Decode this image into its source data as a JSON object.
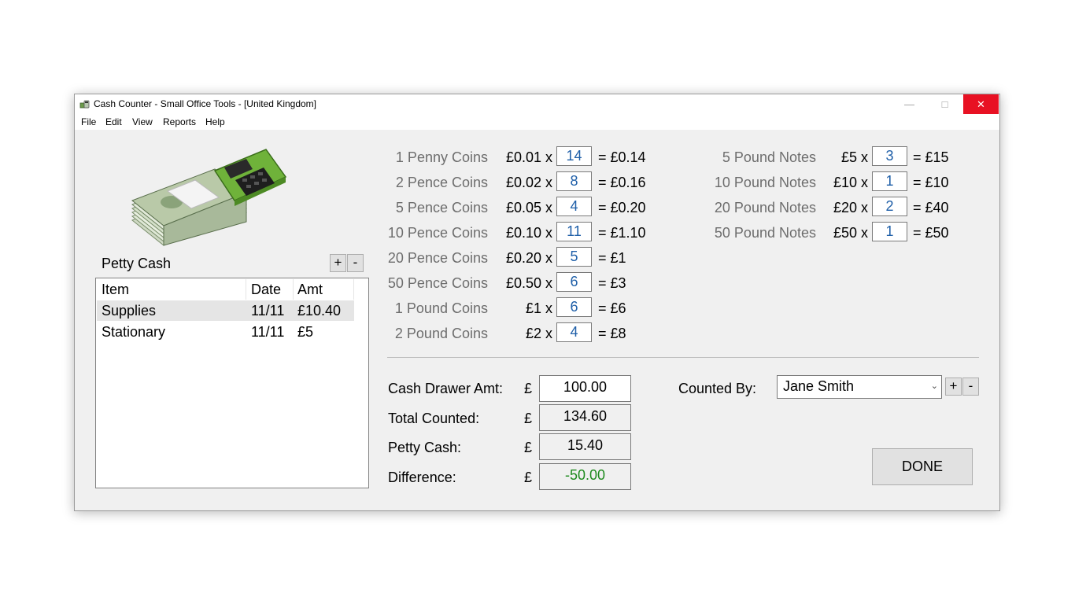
{
  "window": {
    "title": "Cash Counter - Small Office Tools - [United Kingdom]",
    "minimize_glyph": "—",
    "maximize_glyph": "□",
    "close_glyph": "✕"
  },
  "menu": [
    "File",
    "Edit",
    "View",
    "Reports",
    "Help"
  ],
  "petty_cash": {
    "label": "Petty Cash",
    "add_label": "+",
    "remove_label": "-",
    "columns": [
      "Item",
      "Date",
      "Amt"
    ],
    "rows": [
      {
        "item": "Supplies",
        "date": "11/11",
        "amt": "£10.40"
      },
      {
        "item": "Stationary",
        "date": "11/11",
        "amt": "£5"
      }
    ]
  },
  "coins": [
    {
      "name": "1 Penny Coins",
      "value": "£0.01 x",
      "qty": "14",
      "result": "= £0.14"
    },
    {
      "name": "2 Pence Coins",
      "value": "£0.02 x",
      "qty": "8",
      "result": "= £0.16"
    },
    {
      "name": "5 Pence Coins",
      "value": "£0.05 x",
      "qty": "4",
      "result": "= £0.20"
    },
    {
      "name": "10 Pence Coins",
      "value": "£0.10 x",
      "qty": "11",
      "result": "= £1.10"
    },
    {
      "name": "20 Pence Coins",
      "value": "£0.20 x",
      "qty": "5",
      "result": "= £1"
    },
    {
      "name": "50 Pence Coins",
      "value": "£0.50 x",
      "qty": "6",
      "result": "= £3"
    },
    {
      "name": "1 Pound Coins",
      "value": "£1 x",
      "qty": "6",
      "result": "= £6"
    },
    {
      "name": "2 Pound Coins",
      "value": "£2 x",
      "qty": "4",
      "result": "= £8"
    }
  ],
  "notes": [
    {
      "name": "5 Pound Notes",
      "value": "£5 x",
      "qty": "3",
      "result": "= £15"
    },
    {
      "name": "10 Pound Notes",
      "value": "£10 x",
      "qty": "1",
      "result": "= £10"
    },
    {
      "name": "20 Pound Notes",
      "value": "£20 x",
      "qty": "2",
      "result": "= £40"
    },
    {
      "name": "50 Pound Notes",
      "value": "£50 x",
      "qty": "1",
      "result": "= £50"
    }
  ],
  "summary": {
    "currency": "£",
    "cash_drawer": {
      "label": "Cash Drawer Amt:",
      "value": "100.00"
    },
    "total_counted": {
      "label": "Total Counted:",
      "value": "134.60"
    },
    "petty_cash": {
      "label": "Petty Cash:",
      "value": "15.40"
    },
    "difference": {
      "label": "Difference:",
      "value": "-50.00",
      "color": "#1e8a1e"
    }
  },
  "counted_by": {
    "label": "Counted By:",
    "value": "Jane Smith",
    "add_label": "+",
    "remove_label": "-"
  },
  "done_label": "DONE",
  "colors": {
    "close_button": "#e81123",
    "qty_text": "#1f5fa8",
    "denomination_text": "#6d6d6d"
  }
}
